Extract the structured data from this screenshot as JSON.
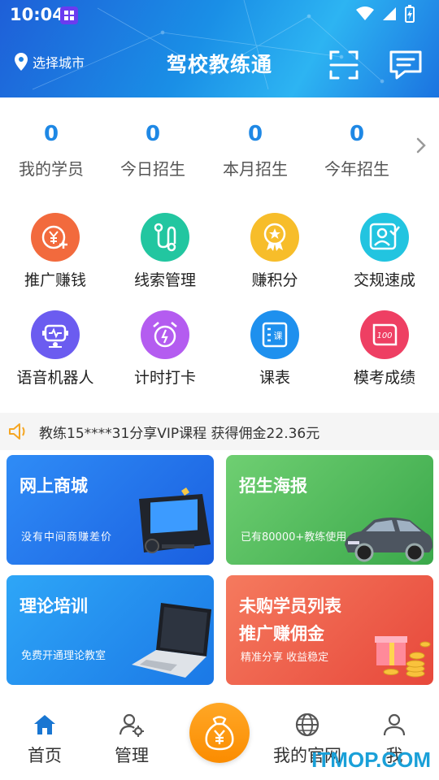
{
  "status_bar": {
    "time": "10:04"
  },
  "header": {
    "city_label": "选择城市",
    "title": "驾校教练通",
    "icons": [
      "location-icon",
      "scan-icon",
      "message-icon"
    ]
  },
  "stats": [
    {
      "value": "0",
      "label": "我的学员"
    },
    {
      "value": "0",
      "label": "今日招生"
    },
    {
      "value": "0",
      "label": "本月招生"
    },
    {
      "value": "0",
      "label": "今年招生"
    }
  ],
  "features": [
    {
      "label": "推广赚钱",
      "icon": "money-plus-icon",
      "color": "#f26a3d"
    },
    {
      "label": "线索管理",
      "icon": "route-icon",
      "color": "#22c6a0"
    },
    {
      "label": "赚积分",
      "icon": "medal-icon",
      "color": "#f7bd2a"
    },
    {
      "label": "交规速成",
      "icon": "user-check-icon",
      "color": "#22c4e0"
    },
    {
      "label": "语音机器人",
      "icon": "robot-icon",
      "color": "#6b5cf0"
    },
    {
      "label": "计时打卡",
      "icon": "alarm-clock-icon",
      "color": "#b45cf0"
    },
    {
      "label": "课表",
      "icon": "schedule-icon",
      "color": "#1e90ee"
    },
    {
      "label": "模考成绩",
      "icon": "score-icon",
      "color": "#ee3f63"
    }
  ],
  "notice": {
    "text": "教练15****31分享VIP课程 获得佣金22.36元"
  },
  "cards": {
    "shop": {
      "title": "网上商城",
      "subtitle": "没有中间商赚差价"
    },
    "poster": {
      "title": "招生海报",
      "subtitle": "已有80000+教练使用"
    },
    "theory": {
      "title": "理论培训",
      "subtitle": "免费开通理论教室"
    },
    "unpaid": {
      "title": "未购学员列表",
      "title2": "推广赚佣金",
      "subtitle": "精准分享 收益稳定"
    }
  },
  "bottom_nav": [
    {
      "label": "首页",
      "icon": "home-icon"
    },
    {
      "label": "管理",
      "icon": "manage-icon"
    },
    {
      "label": "我的官网",
      "icon": "globe-icon"
    },
    {
      "label": "我",
      "icon": "user-icon"
    }
  ],
  "watermark": "ITMOP.COM"
}
